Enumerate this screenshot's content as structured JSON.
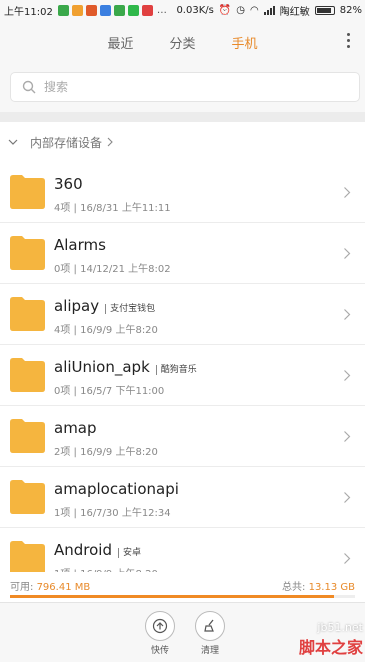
{
  "status_bar": {
    "time": "上午11:02",
    "speed": "0.03K/s",
    "carrier": "陶红敏",
    "battery": "82%",
    "notification_colors": [
      "#3aa84a",
      "#f0a030",
      "#e05a2a",
      "#3b7fe0",
      "#3aa84a",
      "#2fb84a",
      "#e04040"
    ]
  },
  "tabs": [
    {
      "label": "最近",
      "active": false
    },
    {
      "label": "分类",
      "active": false
    },
    {
      "label": "手机",
      "active": true
    }
  ],
  "search": {
    "placeholder": "搜索"
  },
  "breadcrumb": {
    "label": "内部存储设备"
  },
  "files": [
    {
      "name": "360",
      "tag": "",
      "meta": "4项 | 16/8/31 上午11:11"
    },
    {
      "name": "Alarms",
      "tag": "",
      "meta": "0项 | 14/12/21 上午8:02"
    },
    {
      "name": "alipay",
      "tag": "支付宝钱包",
      "meta": "4项 | 16/9/9 上午8:20"
    },
    {
      "name": "aliUnion_apk",
      "tag": "酷狗音乐",
      "meta": "0项 | 16/5/7 下午11:00"
    },
    {
      "name": "amap",
      "tag": "",
      "meta": "2项 | 16/9/9 上午8:20"
    },
    {
      "name": "amaplocationapi",
      "tag": "",
      "meta": "1项 | 16/7/30 上午12:34"
    },
    {
      "name": "Android",
      "tag": "安卓",
      "meta": "1项 | 16/9/9 上午8:20"
    }
  ],
  "storage": {
    "used_label": "可用:",
    "used_value": "796.41 MB",
    "total_label": "总共:",
    "total_value": "13.13 GB",
    "used_fraction": 0.94
  },
  "toolbar": {
    "share_label": "快传",
    "clean_label": "清理"
  },
  "colors": {
    "accent": "#e88a2a",
    "folder": "#f5b53f"
  },
  "watermark": {
    "url": "jb51.net",
    "site": "脚本之家"
  }
}
